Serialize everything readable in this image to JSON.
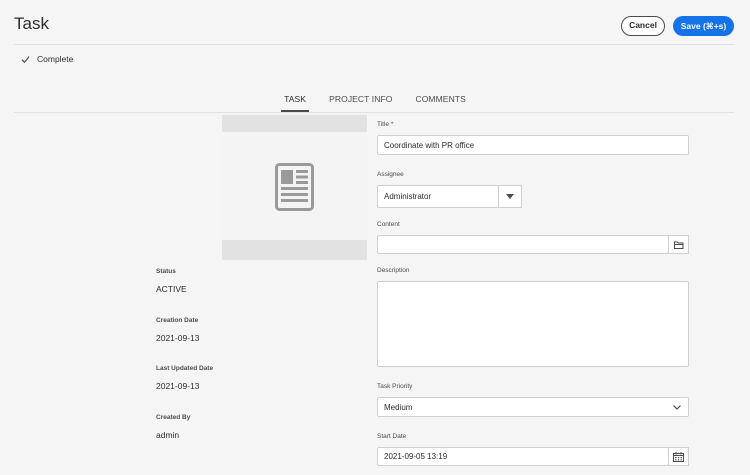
{
  "header": {
    "title": "Task",
    "cancel_label": "Cancel",
    "save_label": "Save (⌘+s)"
  },
  "status_toggle": {
    "label": "Complete"
  },
  "tabs": [
    {
      "label": "TASK",
      "active": true
    },
    {
      "label": "PROJECT INFO",
      "active": false
    },
    {
      "label": "COMMENTS",
      "active": false
    }
  ],
  "meta": {
    "status_label": "Status",
    "status_value": "ACTIVE",
    "creation_label": "Creation Date",
    "creation_value": "2021-09-13",
    "updated_label": "Last Updated Date",
    "updated_value": "2021-09-13",
    "created_by_label": "Created By",
    "created_by_value": "admin"
  },
  "form": {
    "title_label": "Title *",
    "title_value": "Coordinate with PR office",
    "assignee_label": "Assignee",
    "assignee_value": "Administrator",
    "content_label": "Content",
    "content_value": "",
    "description_label": "Description",
    "description_value": "",
    "priority_label": "Task Priority",
    "priority_value": "Medium",
    "start_label": "Start Date",
    "start_value": "2021-09-05 13:19"
  },
  "colors": {
    "accent": "#1473e6",
    "background": "#f5f5f5"
  }
}
